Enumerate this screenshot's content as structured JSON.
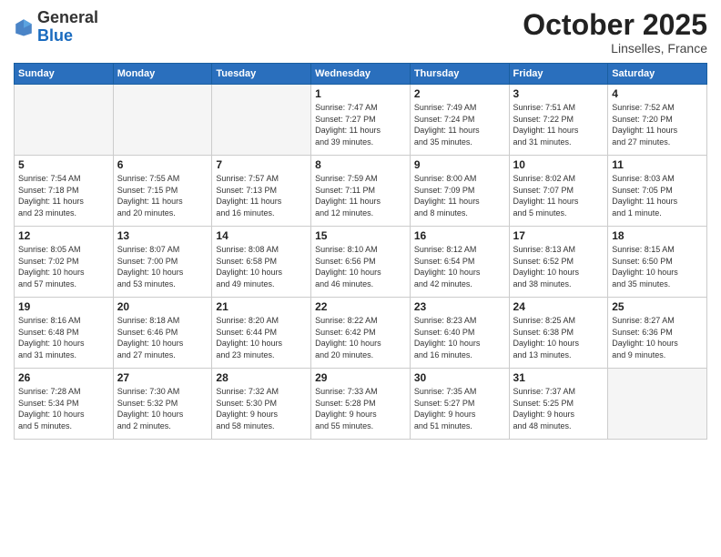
{
  "header": {
    "logo_general": "General",
    "logo_blue": "Blue",
    "month": "October 2025",
    "location": "Linselles, France"
  },
  "days_of_week": [
    "Sunday",
    "Monday",
    "Tuesday",
    "Wednesday",
    "Thursday",
    "Friday",
    "Saturday"
  ],
  "weeks": [
    [
      {
        "day": "",
        "info": ""
      },
      {
        "day": "",
        "info": ""
      },
      {
        "day": "",
        "info": ""
      },
      {
        "day": "1",
        "info": "Sunrise: 7:47 AM\nSunset: 7:27 PM\nDaylight: 11 hours\nand 39 minutes."
      },
      {
        "day": "2",
        "info": "Sunrise: 7:49 AM\nSunset: 7:24 PM\nDaylight: 11 hours\nand 35 minutes."
      },
      {
        "day": "3",
        "info": "Sunrise: 7:51 AM\nSunset: 7:22 PM\nDaylight: 11 hours\nand 31 minutes."
      },
      {
        "day": "4",
        "info": "Sunrise: 7:52 AM\nSunset: 7:20 PM\nDaylight: 11 hours\nand 27 minutes."
      }
    ],
    [
      {
        "day": "5",
        "info": "Sunrise: 7:54 AM\nSunset: 7:18 PM\nDaylight: 11 hours\nand 23 minutes."
      },
      {
        "day": "6",
        "info": "Sunrise: 7:55 AM\nSunset: 7:15 PM\nDaylight: 11 hours\nand 20 minutes."
      },
      {
        "day": "7",
        "info": "Sunrise: 7:57 AM\nSunset: 7:13 PM\nDaylight: 11 hours\nand 16 minutes."
      },
      {
        "day": "8",
        "info": "Sunrise: 7:59 AM\nSunset: 7:11 PM\nDaylight: 11 hours\nand 12 minutes."
      },
      {
        "day": "9",
        "info": "Sunrise: 8:00 AM\nSunset: 7:09 PM\nDaylight: 11 hours\nand 8 minutes."
      },
      {
        "day": "10",
        "info": "Sunrise: 8:02 AM\nSunset: 7:07 PM\nDaylight: 11 hours\nand 5 minutes."
      },
      {
        "day": "11",
        "info": "Sunrise: 8:03 AM\nSunset: 7:05 PM\nDaylight: 11 hours\nand 1 minute."
      }
    ],
    [
      {
        "day": "12",
        "info": "Sunrise: 8:05 AM\nSunset: 7:02 PM\nDaylight: 10 hours\nand 57 minutes."
      },
      {
        "day": "13",
        "info": "Sunrise: 8:07 AM\nSunset: 7:00 PM\nDaylight: 10 hours\nand 53 minutes."
      },
      {
        "day": "14",
        "info": "Sunrise: 8:08 AM\nSunset: 6:58 PM\nDaylight: 10 hours\nand 49 minutes."
      },
      {
        "day": "15",
        "info": "Sunrise: 8:10 AM\nSunset: 6:56 PM\nDaylight: 10 hours\nand 46 minutes."
      },
      {
        "day": "16",
        "info": "Sunrise: 8:12 AM\nSunset: 6:54 PM\nDaylight: 10 hours\nand 42 minutes."
      },
      {
        "day": "17",
        "info": "Sunrise: 8:13 AM\nSunset: 6:52 PM\nDaylight: 10 hours\nand 38 minutes."
      },
      {
        "day": "18",
        "info": "Sunrise: 8:15 AM\nSunset: 6:50 PM\nDaylight: 10 hours\nand 35 minutes."
      }
    ],
    [
      {
        "day": "19",
        "info": "Sunrise: 8:16 AM\nSunset: 6:48 PM\nDaylight: 10 hours\nand 31 minutes."
      },
      {
        "day": "20",
        "info": "Sunrise: 8:18 AM\nSunset: 6:46 PM\nDaylight: 10 hours\nand 27 minutes."
      },
      {
        "day": "21",
        "info": "Sunrise: 8:20 AM\nSunset: 6:44 PM\nDaylight: 10 hours\nand 23 minutes."
      },
      {
        "day": "22",
        "info": "Sunrise: 8:22 AM\nSunset: 6:42 PM\nDaylight: 10 hours\nand 20 minutes."
      },
      {
        "day": "23",
        "info": "Sunrise: 8:23 AM\nSunset: 6:40 PM\nDaylight: 10 hours\nand 16 minutes."
      },
      {
        "day": "24",
        "info": "Sunrise: 8:25 AM\nSunset: 6:38 PM\nDaylight: 10 hours\nand 13 minutes."
      },
      {
        "day": "25",
        "info": "Sunrise: 8:27 AM\nSunset: 6:36 PM\nDaylight: 10 hours\nand 9 minutes."
      }
    ],
    [
      {
        "day": "26",
        "info": "Sunrise: 7:28 AM\nSunset: 5:34 PM\nDaylight: 10 hours\nand 5 minutes."
      },
      {
        "day": "27",
        "info": "Sunrise: 7:30 AM\nSunset: 5:32 PM\nDaylight: 10 hours\nand 2 minutes."
      },
      {
        "day": "28",
        "info": "Sunrise: 7:32 AM\nSunset: 5:30 PM\nDaylight: 9 hours\nand 58 minutes."
      },
      {
        "day": "29",
        "info": "Sunrise: 7:33 AM\nSunset: 5:28 PM\nDaylight: 9 hours\nand 55 minutes."
      },
      {
        "day": "30",
        "info": "Sunrise: 7:35 AM\nSunset: 5:27 PM\nDaylight: 9 hours\nand 51 minutes."
      },
      {
        "day": "31",
        "info": "Sunrise: 7:37 AM\nSunset: 5:25 PM\nDaylight: 9 hours\nand 48 minutes."
      },
      {
        "day": "",
        "info": ""
      }
    ]
  ]
}
